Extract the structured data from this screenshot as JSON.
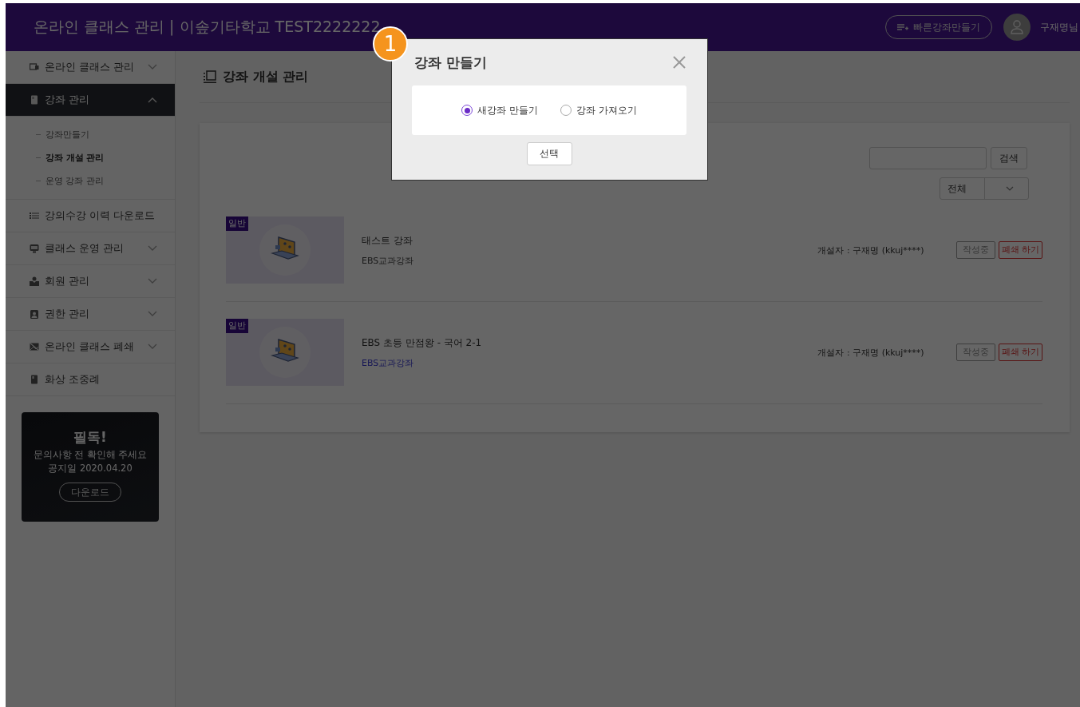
{
  "header": {
    "title": "온라인 클래스 관리 | 이솦기타학교 TEST2222222",
    "quick_button": "빠른강좌만들기",
    "user_name": "구재명님"
  },
  "sidebar": {
    "items": [
      {
        "label": "온라인 클래스 관리",
        "kind": "group",
        "expanded": false,
        "selected": false
      },
      {
        "label": "강좌 관리",
        "kind": "group",
        "expanded": true,
        "selected": true,
        "children": [
          {
            "label": "강좌만들기",
            "selected": false
          },
          {
            "label": "강좌 개설 관리",
            "selected": true
          },
          {
            "label": "운영 강좌 관리",
            "selected": false
          }
        ]
      },
      {
        "label": "강의수강 이력 다운로드",
        "kind": "link",
        "selected": false
      },
      {
        "label": "클래스 운영 관리",
        "kind": "group",
        "expanded": false,
        "selected": false
      },
      {
        "label": "회원 관리",
        "kind": "group",
        "expanded": false,
        "selected": false
      },
      {
        "label": "권한 관리",
        "kind": "group",
        "expanded": false,
        "selected": false
      },
      {
        "label": "온라인 클래스 폐쇄",
        "kind": "group",
        "expanded": false,
        "selected": false
      },
      {
        "label": "화상 조중례",
        "kind": "link",
        "selected": false
      }
    ]
  },
  "notice": {
    "title": "필독!",
    "text": "문의사항 전 확인해 주세요",
    "date": "공지일 2020.04.20",
    "button": "다운로드"
  },
  "page_title": "강좌 개설 관리",
  "search": {
    "button": "검색"
  },
  "filter": {
    "value": "전체"
  },
  "courses": [
    {
      "tag": "일반",
      "title": "태스트 강좌",
      "category": "EBS교과강좌",
      "category_highlighted": false,
      "creator": "개설자 : 구재명 (kkuj****)",
      "status": "작성중",
      "close_button": "폐쇄 하기"
    },
    {
      "tag": "일반",
      "title": "EBS 초등 만점왕 - 국어 2-1",
      "category": "EBS교과강좌",
      "category_highlighted": true,
      "creator": "개설자 : 구재명 (kkuj****)",
      "status": "작성중",
      "close_button": "폐쇄 하기"
    }
  ],
  "modal": {
    "step_badge": "1",
    "title": "강좌 만들기",
    "options": [
      {
        "label": "새강좌 만들기",
        "selected": true
      },
      {
        "label": "강좌 가져오기",
        "selected": false
      }
    ],
    "button": "선택"
  }
}
